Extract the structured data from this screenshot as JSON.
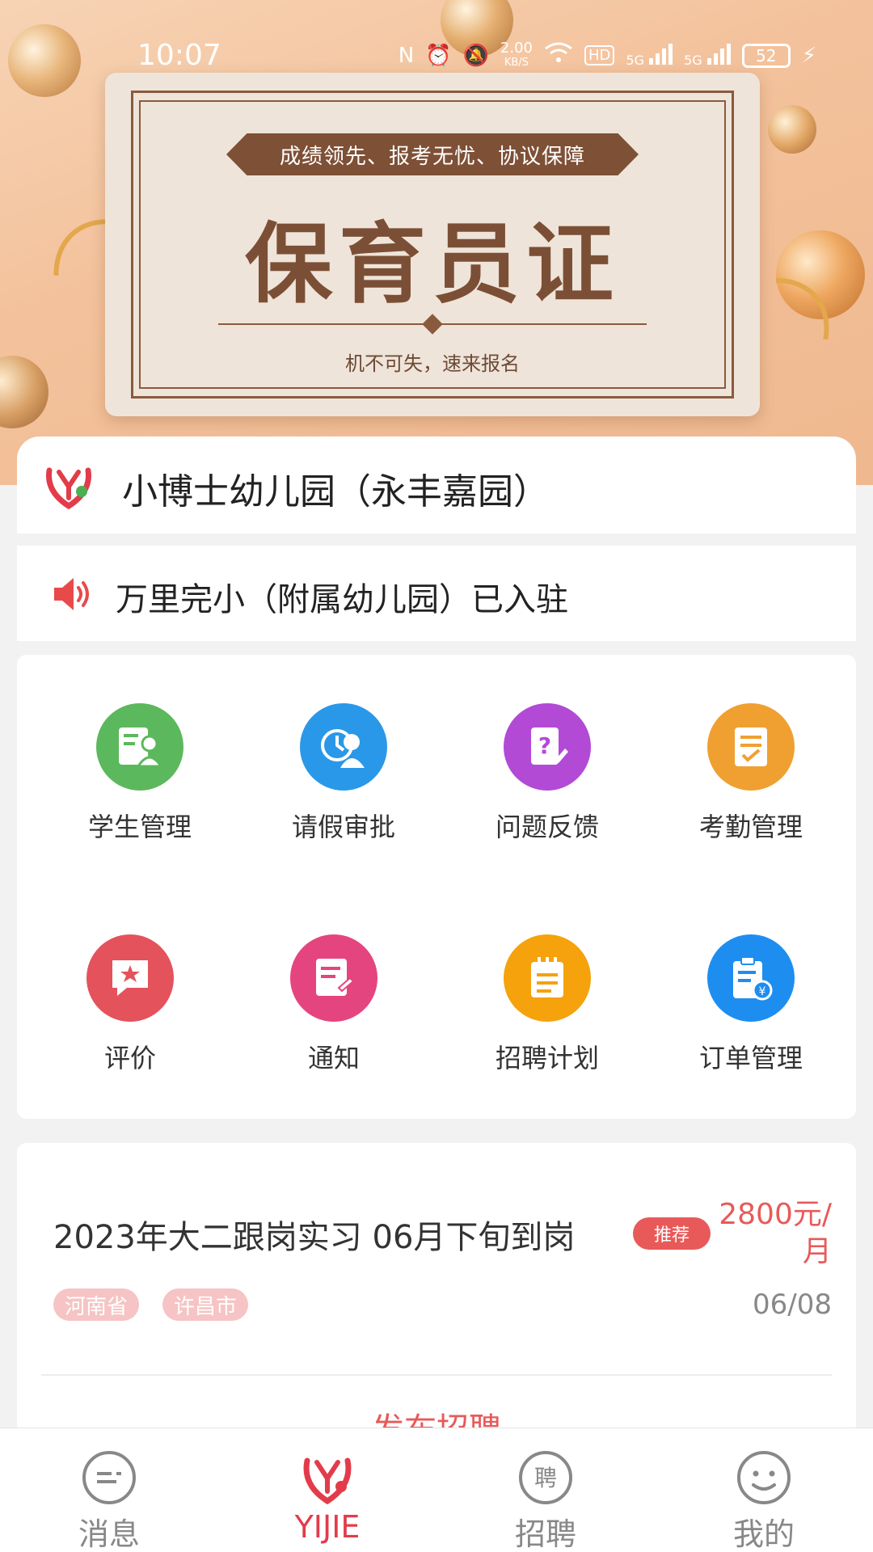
{
  "status_bar": {
    "time": "10:07",
    "net_speed": "2.00",
    "net_unit": "KB/S",
    "hd": "HD",
    "sig1": "5G",
    "sig2": "5G",
    "battery": "52"
  },
  "banner": {
    "tagline": "成绩领先、报考无忧、协议保障",
    "title": "保育员证",
    "subtitle": "机不可失，速来报名"
  },
  "school": {
    "name": "小博士幼儿园（永丰嘉园）"
  },
  "notice": {
    "text": "万里完小（附属幼儿园）已入驻"
  },
  "grid": [
    {
      "label": "学生管理",
      "color": "#5cb85c"
    },
    {
      "label": "请假审批",
      "color": "#2a98e8"
    },
    {
      "label": "问题反馈",
      "color": "#b24ad6"
    },
    {
      "label": "考勤管理",
      "color": "#f0a030"
    },
    {
      "label": "评价",
      "color": "#e4525c"
    },
    {
      "label": "通知",
      "color": "#e5457e"
    },
    {
      "label": "招聘计划",
      "color": "#f5a20d"
    },
    {
      "label": "订单管理",
      "color": "#1d8ef0"
    }
  ],
  "job": {
    "title": "2023年大二跟岗实习 06月下旬到岗",
    "badge": "推荐",
    "salary": "2800元/月",
    "tags": [
      "河南省",
      "许昌市"
    ],
    "date": "06/08",
    "publish_label": "发布招聘"
  },
  "tabs": [
    {
      "label": "消息",
      "active": false
    },
    {
      "label": "YIJIE",
      "active": true
    },
    {
      "label": "招聘",
      "active": false,
      "icon_char": "聘"
    },
    {
      "label": "我的",
      "active": false
    }
  ],
  "colors": {
    "accent": "#e23c4b",
    "banner_brown": "#7b4f36"
  }
}
